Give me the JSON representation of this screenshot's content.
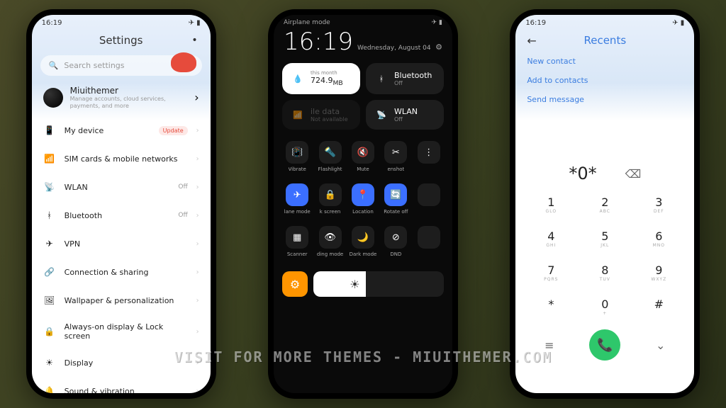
{
  "status": {
    "time": "16:19"
  },
  "phone1": {
    "title": "Settings",
    "search_placeholder": "Search settings",
    "account": {
      "name": "Miuithemer",
      "sub": "Manage accounts, cloud services, payments, and more"
    },
    "rows": [
      {
        "icon": "📱",
        "label": "My device",
        "badge": "Update"
      },
      {
        "icon": "📶",
        "label": "SIM cards & mobile networks"
      },
      {
        "icon": "📡",
        "label": "WLAN",
        "val": "Off"
      },
      {
        "icon": "ᚼ",
        "label": "Bluetooth",
        "val": "Off"
      },
      {
        "icon": "✈",
        "label": "VPN"
      },
      {
        "icon": "🔗",
        "label": "Connection & sharing"
      },
      {
        "icon": "🖼",
        "label": "Wallpaper & personalization"
      },
      {
        "icon": "🔒",
        "label": "Always-on display & Lock screen"
      },
      {
        "icon": "☀",
        "label": "Display"
      },
      {
        "icon": "🔔",
        "label": "Sound & vibration"
      }
    ]
  },
  "phone2": {
    "mode": "Airplane mode",
    "time": "16:19",
    "date": "Wednesday, August 04",
    "tiles": [
      {
        "kind": "data",
        "label": "this month",
        "value": "724.9",
        "unit": "MB"
      },
      {
        "kind": "bt",
        "label": "Bluetooth",
        "sub": "Off"
      },
      {
        "kind": "mobile",
        "label": "ile data",
        "sub": "Not available"
      },
      {
        "kind": "wlan",
        "label": "WLAN",
        "sub": "Off"
      }
    ],
    "toggles": [
      {
        "icon": "📳",
        "label": "Vibrate",
        "on": false
      },
      {
        "icon": "🔦",
        "label": "Flashlight",
        "on": false
      },
      {
        "icon": "🔇",
        "label": "Mute",
        "on": false
      },
      {
        "icon": "✂",
        "label": "enshot",
        "on": false
      },
      {
        "icon": "⋮",
        "label": "",
        "on": false
      },
      {
        "icon": "✈",
        "label": "lane mode",
        "on": true
      },
      {
        "icon": "🔒",
        "label": "k screen",
        "on": false
      },
      {
        "icon": "📍",
        "label": "Location",
        "on": true
      },
      {
        "icon": "🔄",
        "label": "Rotate off",
        "on": true
      },
      {
        "icon": "",
        "label": "",
        "on": false
      },
      {
        "icon": "▦",
        "label": "Scanner",
        "on": false
      },
      {
        "icon": "👁",
        "label": "ding mode",
        "on": false
      },
      {
        "icon": "🌙",
        "label": "Dark mode",
        "on": false
      },
      {
        "icon": "⊘",
        "label": "DND",
        "on": false
      },
      {
        "icon": "",
        "label": "",
        "on": false
      }
    ]
  },
  "phone3": {
    "title": "Recents",
    "links": [
      "New contact",
      "Add to contacts",
      "Send message"
    ],
    "number": "*0*",
    "keys": [
      {
        "n": "1",
        "s": "GLO"
      },
      {
        "n": "2",
        "s": "ABC"
      },
      {
        "n": "3",
        "s": "DEF"
      },
      {
        "n": "4",
        "s": "GHI"
      },
      {
        "n": "5",
        "s": "JKL"
      },
      {
        "n": "6",
        "s": "MNO"
      },
      {
        "n": "7",
        "s": "PQRS"
      },
      {
        "n": "8",
        "s": "TUV"
      },
      {
        "n": "9",
        "s": "WXYZ"
      },
      {
        "n": "*",
        "s": ""
      },
      {
        "n": "0",
        "s": "+"
      },
      {
        "n": "#",
        "s": ""
      }
    ]
  },
  "watermark": "VISIT FOR MORE THEMES - MIUITHEMER.COM"
}
